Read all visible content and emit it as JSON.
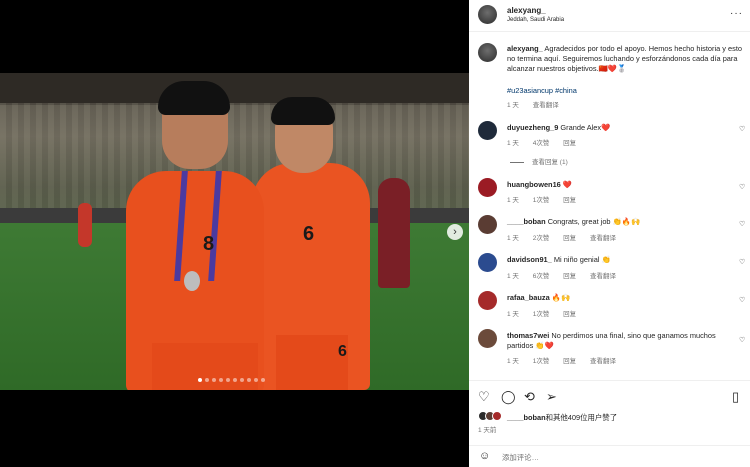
{
  "post": {
    "username": "alexyang_",
    "location": "Jeddah, Saudi Arabia",
    "more": "···",
    "caption_user": "alexyang_",
    "caption_text": "Agradecidos por todo el apoyo. Hemos hecho historia y esto no termina aquí. Seguiremos luchando y esforzándonos cada día para alcanzar nuestros objetivos.🇨🇳❤️🥈",
    "hashtags": "#u23asiancup #china",
    "caption_time": "1 天",
    "caption_translate": "查看翻译"
  },
  "photo": {
    "player1_number": "8",
    "player2_number": "6",
    "player2_shorts_number": "6"
  },
  "comments": [
    {
      "user": "duyuezheng_9",
      "text": "Grande Alex❤️",
      "time": "1 天",
      "likes": "4次赞",
      "reply": "回复"
    },
    {
      "user": "huangbowen16",
      "text": "❤️",
      "time": "1 天",
      "likes": "1次赞",
      "reply": "回复"
    },
    {
      "user": "____boban",
      "text": "Congrats, great job 👏🔥🙌",
      "time": "1 天",
      "likes": "2次赞",
      "reply": "回复",
      "translate": "查看翻译"
    },
    {
      "user": "davidson91_",
      "text": "Mi niño genial 👏",
      "time": "1 天",
      "likes": "6次赞",
      "reply": "回复",
      "translate": "查看翻译"
    },
    {
      "user": "rafaa_bauza",
      "text": "🔥🙌",
      "time": "1 天",
      "likes": "1次赞",
      "reply": "回复"
    },
    {
      "user": "thomas7wei",
      "text": "No perdimos una final, sino que ganamos muchos partidos 👏❤️",
      "time": "1 天",
      "likes": "1次赞",
      "reply": "回复",
      "translate": "查看翻译"
    }
  ],
  "view_replies": "查看回复 (1)",
  "likes_line": {
    "user": "____boban",
    "rest": "和其他409位用户赞了"
  },
  "post_time": "1 天前",
  "add_comment_placeholder": "添加评论…",
  "icons": [
    "heart-icon",
    "comment-icon",
    "share-icon",
    "send-icon",
    "bookmark-icon",
    "emoji-icon",
    "more-icon",
    "next-arrow-icon"
  ],
  "colors": {
    "link": "#00376b",
    "muted": "#737373",
    "jersey": "#e8501e"
  }
}
